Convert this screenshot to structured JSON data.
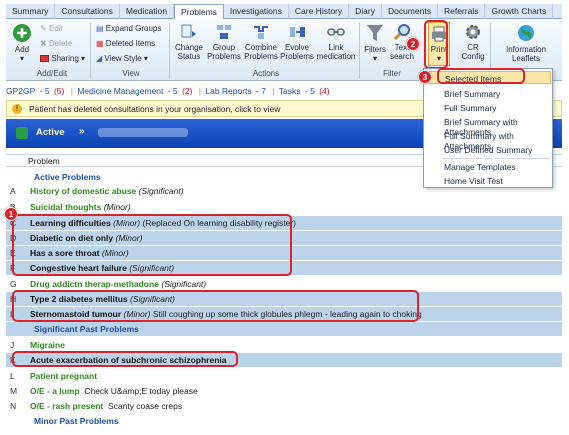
{
  "tabs": [
    "Summary",
    "Consultations",
    "Medication",
    "Problems",
    "Investigations",
    "Care History",
    "Diary",
    "Documents",
    "Referrals",
    "Growth Charts"
  ],
  "active_tab": "Problems",
  "ribbon": {
    "add": "Add",
    "edit": "Edit",
    "delete": "Delete",
    "sharing": "Sharing",
    "add_edit_group": "Add/Edit",
    "expand_groups": "Expand Groups",
    "deleted_items": "Deleted Items",
    "view_style": "View Style",
    "view_group": "View",
    "change_status": [
      "Change",
      "Status"
    ],
    "group_problems": [
      "Group",
      "Problems"
    ],
    "combine_problems": [
      "Combine",
      "Problems"
    ],
    "evolve_problems": [
      "Evolve",
      "Problems"
    ],
    "link_medication": [
      "Link",
      "medication"
    ],
    "actions_group": "Actions",
    "filters": "Filters",
    "text_search": [
      "Text",
      "search"
    ],
    "filter_group": "Filter",
    "print": "Print",
    "cr_config": [
      "CR",
      "Config"
    ],
    "info_leaflets": "Information Leaflets"
  },
  "links": {
    "gp2gp": "GP2GP",
    "gp2gp_count": "5",
    "gp2gp_red": "(5)",
    "medicine": "Medicine Management",
    "medicine_count": "5",
    "medicine_red": "(2)",
    "lab": "Lab Reports",
    "lab_count": "7",
    "tasks": "Tasks",
    "tasks_count": "5",
    "tasks_red": "(4)"
  },
  "warning": "Patient has deleted consultations in your organisation, click to view",
  "active_label": "Active",
  "column_header": "Problem",
  "sections": {
    "active": "Active Problems",
    "sig_past": "Significant Past Problems",
    "minor_past": "Minor Past Problems"
  },
  "rows": [
    {
      "letter": "A",
      "name": "History of domestic abuse",
      "sev": "(Significant)",
      "note": ""
    },
    {
      "letter": "B",
      "name": "Suicidal thoughts",
      "sev": "(Minor)",
      "note": ""
    },
    {
      "letter": "C",
      "name": "Learning difficulties",
      "sev": "(Minor)",
      "note": "(Replaced On learning disability register)"
    },
    {
      "letter": "D",
      "name": "Diabetic on diet only",
      "sev": "(Minor)",
      "note": ""
    },
    {
      "letter": "E",
      "name": "Has a sore throat",
      "sev": "(Minor)",
      "note": ""
    },
    {
      "letter": "F",
      "name": "Congestive heart failure",
      "sev": "(Significant)",
      "note": ""
    },
    {
      "letter": "G",
      "name": "Drug addictn therap-methadone",
      "sev": "(Significant)",
      "note": ""
    },
    {
      "letter": "H",
      "name": "Type 2 diabetes mellitus",
      "sev": "(Significant)",
      "note": ""
    },
    {
      "letter": "I",
      "name": "Sternomastoid tumour",
      "sev": "(Minor)",
      "note": "Still coughing up some thick globules phlegm - leading again to choking"
    },
    {
      "letter": "J",
      "name": "Migraine",
      "sev": "",
      "note": ""
    },
    {
      "letter": "K",
      "name": "Acute exacerbation of subchronic schizophrenia",
      "sev": "",
      "note": ""
    },
    {
      "letter": "L",
      "name": "Patient pregnant",
      "sev": "",
      "note": ""
    },
    {
      "letter": "M",
      "name": "O/E - a lump",
      "sev": "",
      "note": "Check U&amp;E today please"
    },
    {
      "letter": "N",
      "name": "O/E - rash present",
      "sev": "",
      "note": "Scanty coase creps"
    }
  ],
  "dropdown": [
    "Selected Items",
    "Brief Summary",
    "Full Summary",
    "Brief Summary with Attachments",
    "Full Summary with Attachments",
    "User Defined Summary",
    "Manage Templates",
    "Home Visit Test"
  ],
  "callouts": [
    "1",
    "2",
    "3"
  ],
  "colors": {
    "accent": "#0c44b4",
    "callout": "#d9222a",
    "problem_green": "#2e8a1e"
  }
}
